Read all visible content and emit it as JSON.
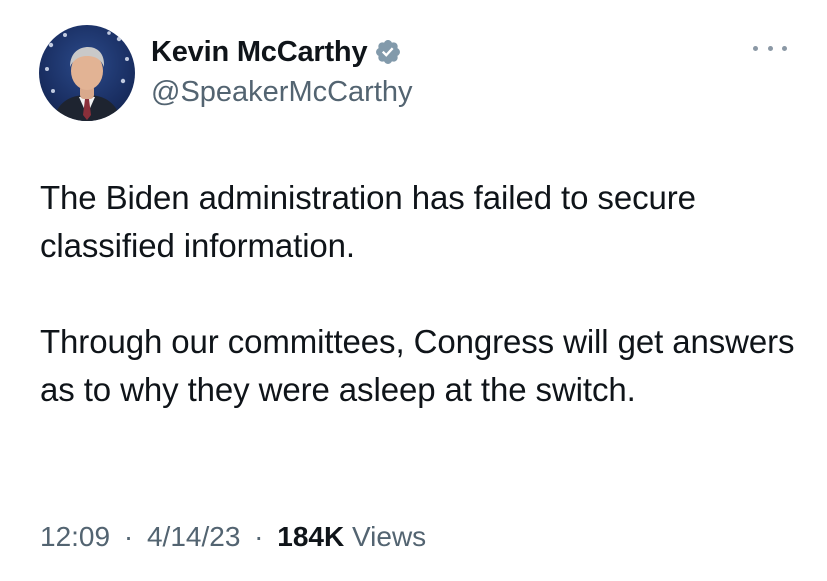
{
  "author": {
    "display_name": "Kevin McCarthy",
    "handle": "@SpeakerMcCarthy",
    "verified_icon": "verified-badge-icon",
    "verified_color": "#829aab"
  },
  "menu": {
    "icon": "more-options-icon"
  },
  "tweet": {
    "paragraphs": [
      "The Biden administration has failed to secure classified information.",
      "Through our committees, Congress will get answers as to why they were asleep at the switch."
    ]
  },
  "meta": {
    "time": "12:09",
    "separator": "·",
    "date": "4/14/23",
    "views_count": "184K",
    "views_label": "Views"
  },
  "colors": {
    "text": "#0f1419",
    "secondary": "#536471"
  }
}
